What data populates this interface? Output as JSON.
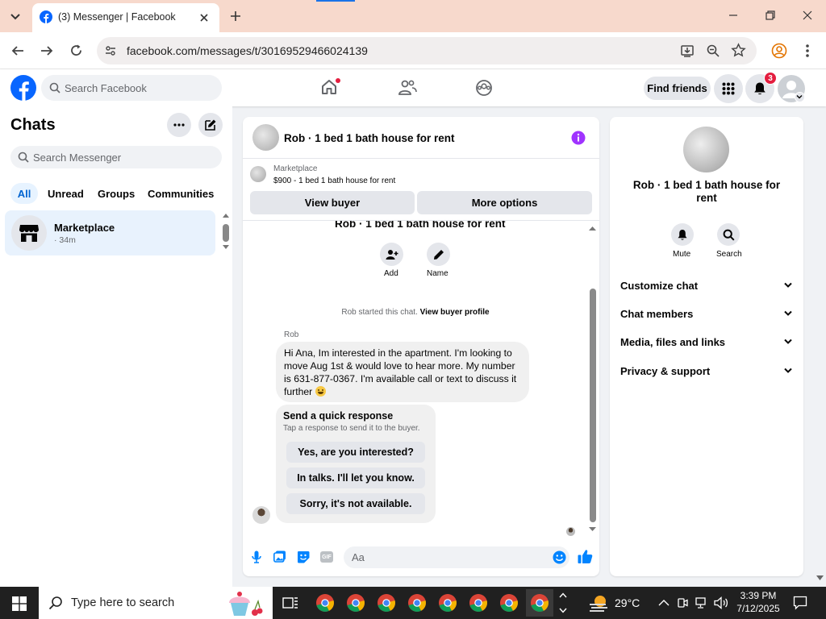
{
  "browser": {
    "tab_title": "(3) Messenger | Facebook",
    "url": "facebook.com/messages/t/30169529466024139"
  },
  "fb_header": {
    "search_placeholder": "Search Facebook",
    "find_friends": "Find friends",
    "notifications_count": "3"
  },
  "chats": {
    "title": "Chats",
    "search_placeholder": "Search Messenger",
    "filters": [
      "All",
      "Unread",
      "Groups",
      "Communities"
    ],
    "items": [
      {
        "name": "Marketplace",
        "time": "· 34m"
      }
    ]
  },
  "conversation": {
    "title": "Rob · 1 bed 1 bath house for rent",
    "marketplace_label": "Marketplace",
    "listing": "$900 - 1 bed 1 bath house for rent",
    "view_buyer": "View buyer",
    "more_options": "More options",
    "header_repeat": "Rob · 1 bed 1 bath house for rent",
    "add_label": "Add",
    "name_label": "Name",
    "started_text": "Rob started this chat.",
    "view_buyer_profile": "View buyer profile",
    "sender": "Rob",
    "message": "Hi Ana, Im interested in the apartment. I'm looking to move Aug 1st & would love to hear more. My number is 631-877-0367. I'm available call or text to discuss it further",
    "quick_title": "Send a quick response",
    "quick_sub": "Tap a response to send it to the buyer.",
    "quick_responses": [
      "Yes, are you interested?",
      "In talks. I'll let you know.",
      "Sorry, it's not available."
    ],
    "composer_placeholder": "Aa",
    "gif_label": "GIF"
  },
  "info": {
    "title": "Rob · 1 bed 1 bath house for rent",
    "mute": "Mute",
    "search": "Search",
    "sections": [
      "Customize chat",
      "Chat members",
      "Media, files and links",
      "Privacy & support"
    ]
  },
  "taskbar": {
    "search_placeholder": "Type here to search",
    "weather": "29°C",
    "time": "3:39 PM",
    "date": "7/12/2025"
  },
  "colors": {
    "fb_blue": "#0866ff",
    "messenger_blue": "#0084ff",
    "accent_purple": "#a033ff",
    "badge_red": "#e41e3f"
  }
}
